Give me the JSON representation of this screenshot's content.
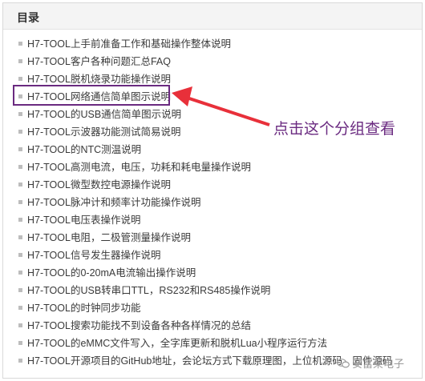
{
  "header": {
    "title": "目录"
  },
  "items": [
    "H7-TOOL上手前准备工作和基础操作整体说明",
    "H7-TOOL客户各种问题汇总FAQ",
    "H7-TOOL脱机烧录功能操作说明",
    "H7-TOOL网络通信简单图示说明",
    "H7-TOOL的USB通信简单图示说明",
    "H7-TOOL示波器功能测试简易说明",
    "H7-TOOL的NTC测温说明",
    "H7-TOOL高测电流，电压，功耗和耗电量操作说明",
    "H7-TOOL微型数控电源操作说明",
    "H7-TOOL脉冲计和频率计功能操作说明",
    "H7-TOOL电压表操作说明",
    "H7-TOOL电阻，二极管测量操作说明",
    "H7-TOOL信号发生器操作说明",
    "H7-TOOL的0-20mA电流输出操作说明",
    "H7-TOOL的USB转串口TTL，RS232和RS485操作说明",
    "H7-TOOL的时钟同步功能",
    "H7-TOOL搜索功能找不到设备各种各样情况的总结",
    "H7-TOOL的eMMC文件写入，全字库更新和脱机Lua小程序运行方法",
    "H7-TOOL开源项目的GitHub地址，会论坛方式下载原理图，上位机源码，固件源码"
  ],
  "annotation": {
    "text": "点击这个分组查看",
    "color": "#6a2a80"
  },
  "watermark": {
    "text": "安富莱电子",
    "icon": "wechat-icon"
  }
}
